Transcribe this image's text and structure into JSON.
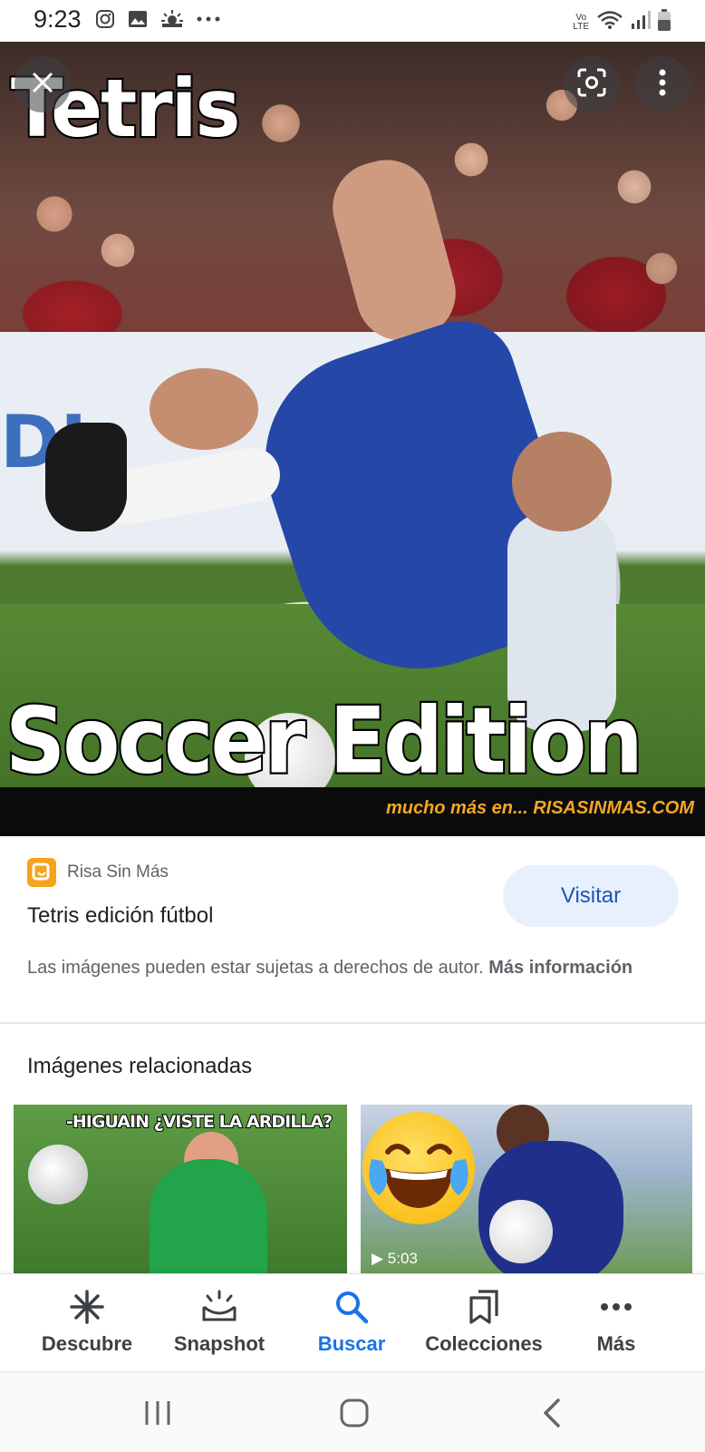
{
  "status_bar": {
    "time": "9:23",
    "volte": "Vo\nLTE"
  },
  "hero": {
    "meme_top_text": "Tetris",
    "meme_bottom_text": "Soccer Edition",
    "credit": "mucho más en... RISASINMAS.COM",
    "board_text": "DI"
  },
  "result": {
    "source_name": "Risa Sin Más",
    "title": "Tetris edición fútbol",
    "visit_label": "Visitar",
    "copyright_text": "Las imágenes pueden estar sujetas a derechos de autor.",
    "more_info_label": "Más información"
  },
  "related": {
    "heading": "Imágenes relacionadas",
    "items": [
      {
        "caption": "-HIGUAIN ¿VISTE LA ARDILLA?"
      },
      {
        "duration": "▶ 5:03"
      }
    ]
  },
  "bottom_nav": {
    "items": [
      {
        "label": "Descubre",
        "icon": "asterisk-icon"
      },
      {
        "label": "Snapshot",
        "icon": "snapshot-icon"
      },
      {
        "label": "Buscar",
        "icon": "search-icon",
        "active": true
      },
      {
        "label": "Colecciones",
        "icon": "bookmarks-icon"
      },
      {
        "label": "Más",
        "icon": "more-horiz-icon"
      }
    ]
  },
  "colors": {
    "accent": "#1a73e8",
    "visit_bg": "#e8f0fe",
    "credit": "#f5a623"
  }
}
